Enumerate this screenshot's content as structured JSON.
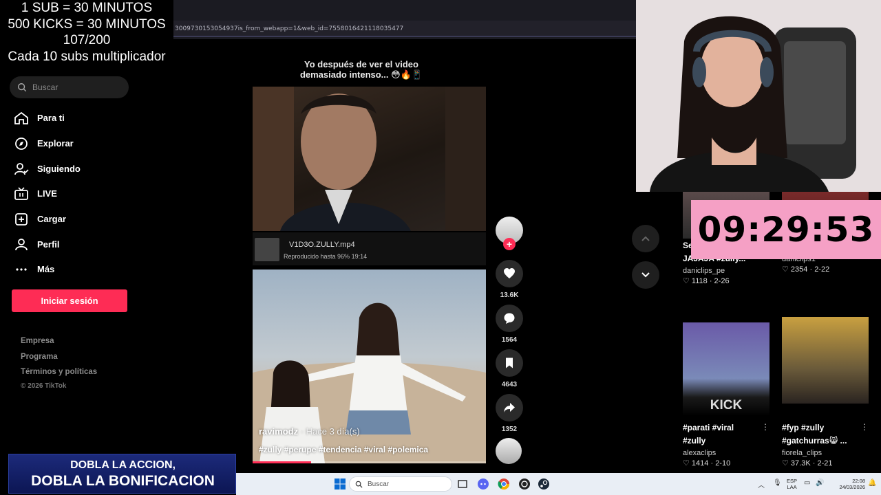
{
  "overlay": {
    "line1": "1 SUB      = 30 MINUTOS",
    "line2": "500 KICKS = 30 MINUTOS",
    "line3": "107/200",
    "line4": "Cada 10 subs multiplicador"
  },
  "browser": {
    "url": "3009730153054937is_from_webapp=1&web_id=7558016421118035477"
  },
  "sidebar": {
    "search_placeholder": "Buscar",
    "items": [
      {
        "label": "Para ti"
      },
      {
        "label": "Explorar"
      },
      {
        "label": "Siguiendo"
      },
      {
        "label": "LIVE"
      },
      {
        "label": "Cargar"
      },
      {
        "label": "Perfil"
      },
      {
        "label": "Más"
      }
    ],
    "login_label": "Iniciar sesión",
    "footer": [
      "Empresa",
      "Programa",
      "Términos y políticas"
    ],
    "copyright": "© 2026 TikTok"
  },
  "feed": {
    "caption_line1": "Yo después de ver el video",
    "caption_line2": "demasiado intenso... 😳🔥📱",
    "file_name": "V1D3O.ZULLY.mp4",
    "file_progress": "Reproducido hasta 96%   19:14",
    "author": "ravimodz",
    "time_ago": " · Hace 3 día(s)",
    "tags": "#zully #perupe #tendencia #viral #polemica",
    "progress_fraction": 0.25
  },
  "actions": {
    "likes": "13.6K",
    "comments": "1564",
    "saves": "4643",
    "shares": "1352"
  },
  "timer": "09:29:53",
  "right_column": {
    "top_left": {
      "title_line1": "Se",
      "title_line2": "JAJAJA #zully...",
      "author": "daniclips_pe",
      "likes": "1118",
      "date": "2-26"
    },
    "top_right": {
      "author": "daniclips1",
      "likes": "2354",
      "date": "2-22"
    },
    "bottom_left": {
      "thumb_text": "KICK",
      "title_line1": "#parati #viral",
      "title_line2": "#zully",
      "author": "alexaclips",
      "likes": "1414",
      "date": "2-10"
    },
    "bottom_right": {
      "title_line1": "#fyp #zully",
      "title_line2": "#gatchurras😸 ...",
      "author": "fiorela_clips",
      "likes": "37.3K",
      "date": "2-21"
    }
  },
  "promo": {
    "line1": "DOBLA LA ACCION,",
    "line2": "DOBLA LA BONIFICACION"
  },
  "taskbar": {
    "search_placeholder": "Buscar",
    "lang_line1": "ESP",
    "lang_line2": "LAA",
    "time": "22:08",
    "date": "24/03/2026"
  }
}
